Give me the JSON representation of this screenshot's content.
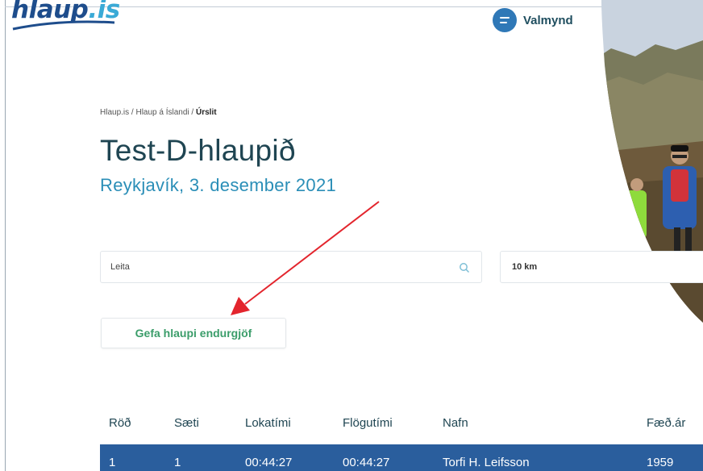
{
  "brand": {
    "logo_main": "hlaup",
    "logo_tld": ".is",
    "colors": {
      "navy": "#1e4d8c",
      "cyan": "#3aaad6",
      "menu": "#2f78b7",
      "green": "#3b9d6a",
      "row": "#2a5e9d"
    }
  },
  "menu": {
    "label": "Valmynd",
    "icon": "hamburger-menu-icon"
  },
  "breadcrumb": {
    "home": "Hlaup.is",
    "sep1": " / ",
    "section": "Hlaup á Íslandi",
    "sep2": " / ",
    "current": "Úrslit"
  },
  "event": {
    "title": "Test-D-hlaupið",
    "subtitle": "Reykjavík, 3. desember 2021"
  },
  "search": {
    "value": "Leita",
    "icon": "search-icon"
  },
  "distance_select": {
    "value": "10 km"
  },
  "feedback_button": {
    "label": "Gefa hlaupi endurgjöf"
  },
  "results_table": {
    "headers": [
      "Röð",
      "Sæti",
      "Lokatími",
      "Flögutími",
      "Nafn",
      "Fæð.ár"
    ],
    "rows": [
      [
        "1",
        "1",
        "00:44:27",
        "00:44:27",
        "Torfi H. Leifsson",
        "1959"
      ]
    ]
  }
}
